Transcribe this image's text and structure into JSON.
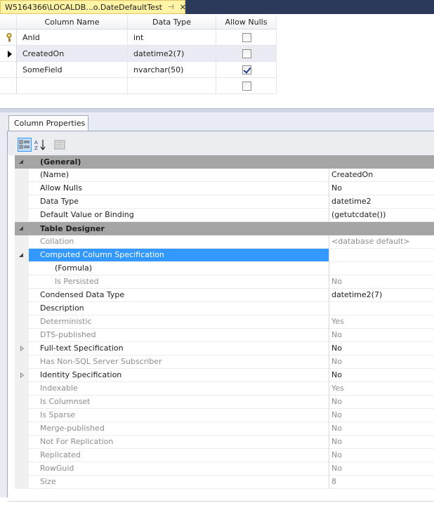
{
  "document_tab": {
    "title": "W5164366\\LOCALDB...o.DateDefaultTest",
    "pin_icon": "pin-icon",
    "close_icon": "close-icon"
  },
  "table_grid": {
    "headers": [
      "Column Name",
      "Data Type",
      "Allow Nulls"
    ],
    "rows": [
      {
        "name": "AnId",
        "type": "int",
        "allow_nulls": false,
        "indicator": "primary-key-icon"
      },
      {
        "name": "CreatedOn",
        "type": "datetime2(7)",
        "allow_nulls": false,
        "indicator": "current-row-arrow-icon"
      },
      {
        "name": "SomeField",
        "type": "nvarchar(50)",
        "allow_nulls": true,
        "indicator": ""
      },
      {
        "name": "",
        "type": "",
        "allow_nulls": false,
        "indicator": ""
      }
    ]
  },
  "properties": {
    "tab_label": "Column Properties",
    "toolbar_icons": [
      "categorized-icon",
      "alphabetical-icon",
      "property-pages-icon"
    ],
    "rows": [
      {
        "kind": "category",
        "label": "(General)",
        "expander": "open"
      },
      {
        "kind": "prop",
        "name": "(Name)",
        "value": "CreatedOn"
      },
      {
        "kind": "prop",
        "name": "Allow Nulls",
        "value": "No"
      },
      {
        "kind": "prop",
        "name": "Data Type",
        "value": "datetime2"
      },
      {
        "kind": "prop",
        "name": "Default Value or Binding",
        "value": "(getutcdate())"
      },
      {
        "kind": "category",
        "label": "Table Designer",
        "expander": "open"
      },
      {
        "kind": "prop",
        "name": "Collation",
        "value": "<database default>",
        "dim": true
      },
      {
        "kind": "prop",
        "name": "Computed Column Specification",
        "value": "",
        "selected": true,
        "expander": "open"
      },
      {
        "kind": "prop",
        "name": "(Formula)",
        "value": "",
        "sub": true
      },
      {
        "kind": "prop",
        "name": "Is Persisted",
        "value": "No",
        "sub": true,
        "dim": true
      },
      {
        "kind": "prop",
        "name": "Condensed Data Type",
        "value": "datetime2(7)"
      },
      {
        "kind": "prop",
        "name": "Description",
        "value": ""
      },
      {
        "kind": "prop",
        "name": "Deterministic",
        "value": "Yes",
        "dim": true
      },
      {
        "kind": "prop",
        "name": "DTS-published",
        "value": "No",
        "dim": true
      },
      {
        "kind": "prop",
        "name": "Full-text Specification",
        "value": "No",
        "expander": "closed"
      },
      {
        "kind": "prop",
        "name": "Has Non-SQL Server Subscriber",
        "value": "No",
        "dim": true
      },
      {
        "kind": "prop",
        "name": "Identity Specification",
        "value": "No",
        "expander": "closed"
      },
      {
        "kind": "prop",
        "name": "Indexable",
        "value": "Yes",
        "dim": true
      },
      {
        "kind": "prop",
        "name": "Is Columnset",
        "value": "No",
        "dim": true
      },
      {
        "kind": "prop",
        "name": "Is Sparse",
        "value": "No",
        "dim": true
      },
      {
        "kind": "prop",
        "name": "Merge-published",
        "value": "No",
        "dim": true
      },
      {
        "kind": "prop",
        "name": "Not For Replication",
        "value": "No",
        "dim": true
      },
      {
        "kind": "prop",
        "name": "Replicated",
        "value": "No",
        "dim": true
      },
      {
        "kind": "prop",
        "name": "RowGuid",
        "value": "No",
        "dim": true
      },
      {
        "kind": "prop",
        "name": "Size",
        "value": "8",
        "dim": true
      }
    ]
  },
  "colors": {
    "tab_active": "#fff3a6",
    "selection": "#3399ff",
    "category": "#a5a5a5"
  }
}
